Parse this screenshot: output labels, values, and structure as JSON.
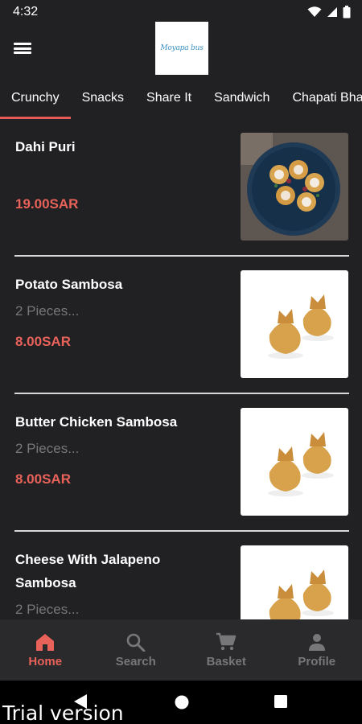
{
  "status_bar": {
    "time": "4:32"
  },
  "header": {
    "logo_text": "Moyapa bus"
  },
  "tabs": [
    {
      "label": "Crunchy",
      "active": true
    },
    {
      "label": "Snacks",
      "active": false
    },
    {
      "label": "Share It",
      "active": false
    },
    {
      "label": "Sandwich",
      "active": false
    },
    {
      "label": "Chapati Bha",
      "active": false
    }
  ],
  "products": [
    {
      "name": "Dahi Puri",
      "description": "",
      "price": "19.00SAR",
      "image": "dahi-puri-plate"
    },
    {
      "name": "Potato Sambosa",
      "description": "2 Pieces...",
      "price": "8.00SAR",
      "image": "sambosa"
    },
    {
      "name": "Butter Chicken Sambosa",
      "description": "2 Pieces...",
      "price": "8.00SAR",
      "image": "sambosa"
    },
    {
      "name": "Cheese With Jalapeno Sambosa",
      "description": "2 Pieces...",
      "price": "",
      "image": "sambosa"
    }
  ],
  "bottom_nav": [
    {
      "label": "Home",
      "icon": "home-icon",
      "active": true
    },
    {
      "label": "Search",
      "icon": "search-icon",
      "active": false
    },
    {
      "label": "Basket",
      "icon": "cart-icon",
      "active": false
    },
    {
      "label": "Profile",
      "icon": "person-icon",
      "active": false
    }
  ],
  "watermark": "Trial version",
  "colors": {
    "accent": "#e8625a",
    "background": "#212124",
    "nav_background": "#2a2a2d"
  }
}
